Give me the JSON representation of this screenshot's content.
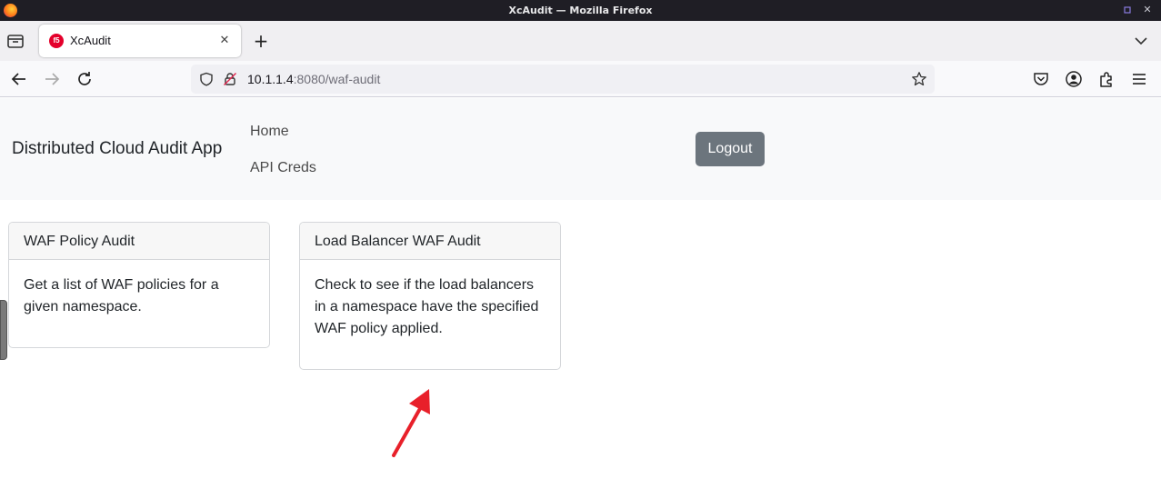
{
  "window": {
    "title": "XcAudit — Mozilla Firefox"
  },
  "tabs": [
    {
      "label": "XcAudit",
      "favicon_text": "f5"
    }
  ],
  "url": {
    "host": "10.1.1.4",
    "rest": ":8080/waf-audit"
  },
  "app": {
    "brand": "Distributed Cloud Audit App",
    "nav": {
      "home": "Home",
      "creds": "API Creds"
    },
    "logout_label": "Logout"
  },
  "cards": [
    {
      "header": "WAF Policy Audit",
      "body": "Get a list of WAF policies for a given namespace."
    },
    {
      "header": "Load Balancer WAF Audit",
      "body": "Check to see if the load balancers in a namespace have the specified WAF policy applied."
    }
  ],
  "colors": {
    "logout_bg": "#6c757d",
    "header_bg": "#f8f9fa",
    "annotation_arrow": "#e8202a"
  }
}
